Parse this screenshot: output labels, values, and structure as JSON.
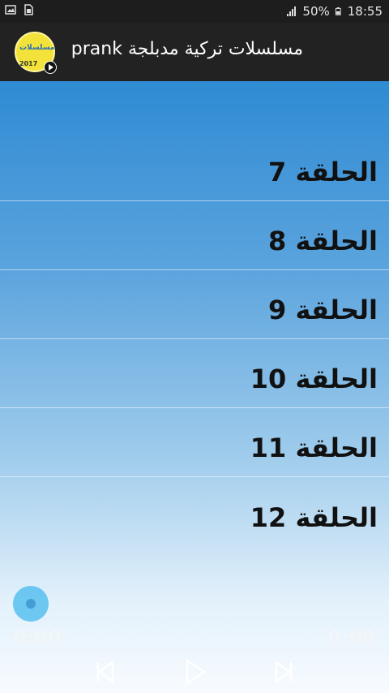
{
  "status_bar": {
    "battery": "50%",
    "time": "18:55",
    "left_icons": [
      "gallery-icon",
      "sim-icon"
    ],
    "right_icons": [
      "signal-icon",
      "battery-icon"
    ]
  },
  "app_bar": {
    "title": "مسلسلات تركية مدبلجة prank",
    "logo": {
      "text": "مسلسلات",
      "year": "2017"
    }
  },
  "episodes": [
    {
      "label": "الحلقة 7"
    },
    {
      "label": "الحلقة 8"
    },
    {
      "label": "الحلقة 9"
    },
    {
      "label": "الحلقة 10"
    },
    {
      "label": "الحلقة 11"
    },
    {
      "label": "الحلقة 12"
    }
  ],
  "player": {
    "elapsed": "0:00",
    "duration": "0:00",
    "progress": 0,
    "controls": [
      "previous-icon",
      "play-icon",
      "next-icon"
    ]
  },
  "colors": {
    "status_bar": "#1d1d1d",
    "app_bar": "#222222",
    "gradient_top": "#2f8bd3",
    "gradient_bottom": "#f7fbff",
    "seek_thumb": "#58c0f0"
  }
}
